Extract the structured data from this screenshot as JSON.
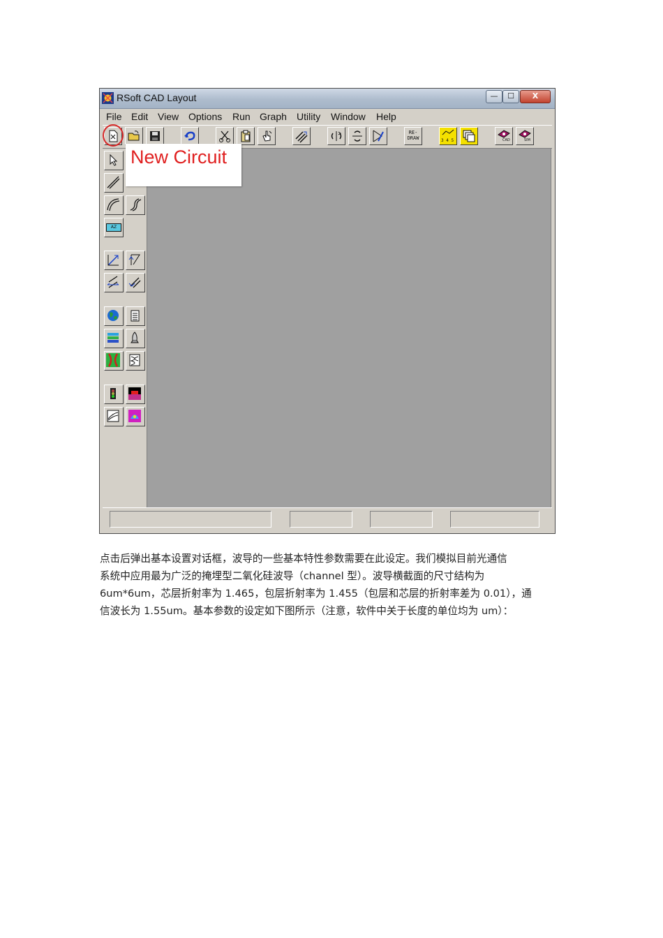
{
  "window": {
    "title": "RSoft CAD Layout",
    "controls": {
      "minimize": "—",
      "maximize": "☐",
      "close": "X"
    }
  },
  "menu": [
    "File",
    "Edit",
    "View",
    "Options",
    "Run",
    "Graph",
    "Utility",
    "Window",
    "Help"
  ],
  "toolbar": {
    "redraw_label": "RE-\nDRAW",
    "cad_label": "CAD",
    "sim_label": "SIM",
    "plot_label": "3 4 5"
  },
  "sidebar": {
    "text_tool_label": "AZ"
  },
  "callout": {
    "text": "New Circuit",
    "color": "#e02020"
  },
  "colors": {
    "canvas": "#a0a0a0",
    "chrome": "#d4d0c8",
    "highlight": "#d62828"
  },
  "paragraph": [
    "点击后弹出基本设置对话框，波导的一些基本特性参数需要在此设定。我们模拟目前光通信",
    "系统中应用最为广泛的掩埋型二氧化硅波导（channel  型）。波导横截面的尺寸结构为",
    "6um*6um，芯层折射率为 1.465，包层折射率为 1.455（包层和芯层的折射率差为 0.01），通",
    "信波长为  1.55um。基本参数的设定如下图所示（注意，软件中关于长度的单位均为 um）："
  ]
}
